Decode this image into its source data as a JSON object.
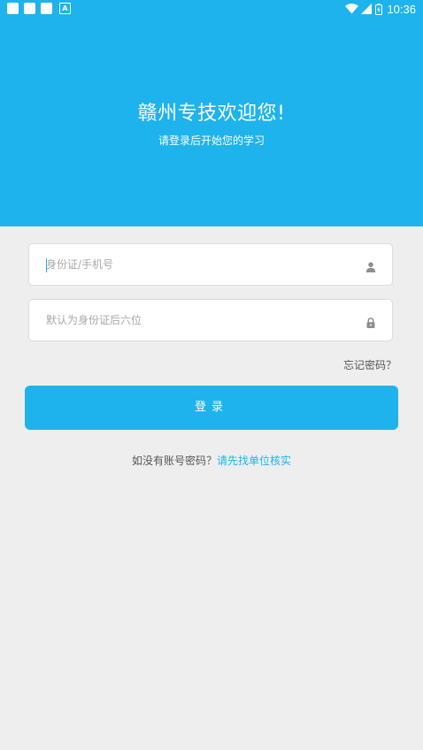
{
  "status_bar": {
    "time": "10:36",
    "notification_icons": [
      "square-icon",
      "square-icon",
      "square-icon",
      "text-a-icon"
    ],
    "notification_a_glyph": "A"
  },
  "header": {
    "title": "赣州专技欢迎您!",
    "subtitle": "请登录后开始您的学习",
    "background_color": "#1eb3ec"
  },
  "form": {
    "username": {
      "placeholder": "身份证/手机号",
      "value": "",
      "icon": "person-icon"
    },
    "password": {
      "placeholder": "默认为身份证后六位",
      "value": "",
      "icon": "lock-icon"
    },
    "forgot_password_label": "忘记密码？",
    "login_label": "登录"
  },
  "footer": {
    "no_account_text": "如没有账号密码？",
    "verify_link": "请先找单位核实"
  },
  "colors": {
    "accent": "#1eb3ec",
    "page_background": "#eeeeee"
  }
}
